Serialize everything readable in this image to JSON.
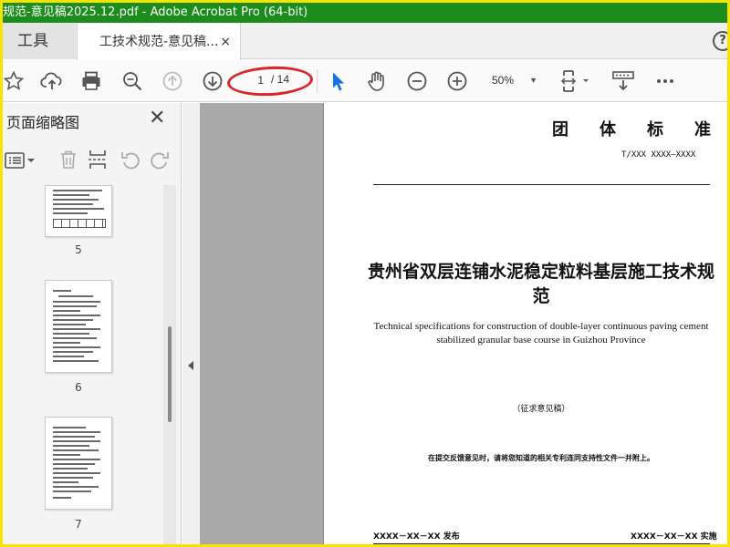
{
  "window": {
    "title": "规范-意见稿2025.12.pdf - Adobe Acrobat Pro (64-bit)"
  },
  "tabs": {
    "tools_label": "工具",
    "document_label": "工技术规范-意见稿...",
    "close_glyph": "×",
    "help_glyph": "?"
  },
  "toolbar": {
    "current_page": "1",
    "total_pages": "/ 14",
    "zoom": "50%"
  },
  "thumbnails_pane": {
    "title": "页面缩略图",
    "close_glyph": "✕",
    "pages": [
      {
        "number": "5"
      },
      {
        "number": "6"
      },
      {
        "number": "7"
      }
    ]
  },
  "document": {
    "standard_type": "团体标准",
    "standard_code": "T/XXX XXXX—XXXX",
    "title_cn": "贵州省双层连铺水泥稳定粒料基层施工技术规范",
    "title_en": "Technical specifications for construction of double-layer continuous paving cement stabilized granular base course in Guizhou Province",
    "draft_note": "（征求意见稿）",
    "submit_note": "在提交反馈意见时，请将您知道的相关专利连同支持性文件一并附上。",
    "issue_date": "XXXX－XX－XX 发布",
    "implement_date": "XXXX－XX－XX 实施"
  },
  "colors": {
    "title_bar": "#1c8c1c",
    "highlight_oval": "#d8262a",
    "select_tool": "#1473e6"
  },
  "icons": [
    "star-icon",
    "cloud-upload-icon",
    "print-icon",
    "zoom-search-icon",
    "prev-page-icon",
    "next-page-icon",
    "select-cursor-icon",
    "hand-icon",
    "zoom-out-icon",
    "zoom-in-icon",
    "page-fit-icon",
    "scroll-mode-icon",
    "more-icon",
    "page-options-icon",
    "delete-icon",
    "insert-icon",
    "undo-icon",
    "redo-icon"
  ]
}
